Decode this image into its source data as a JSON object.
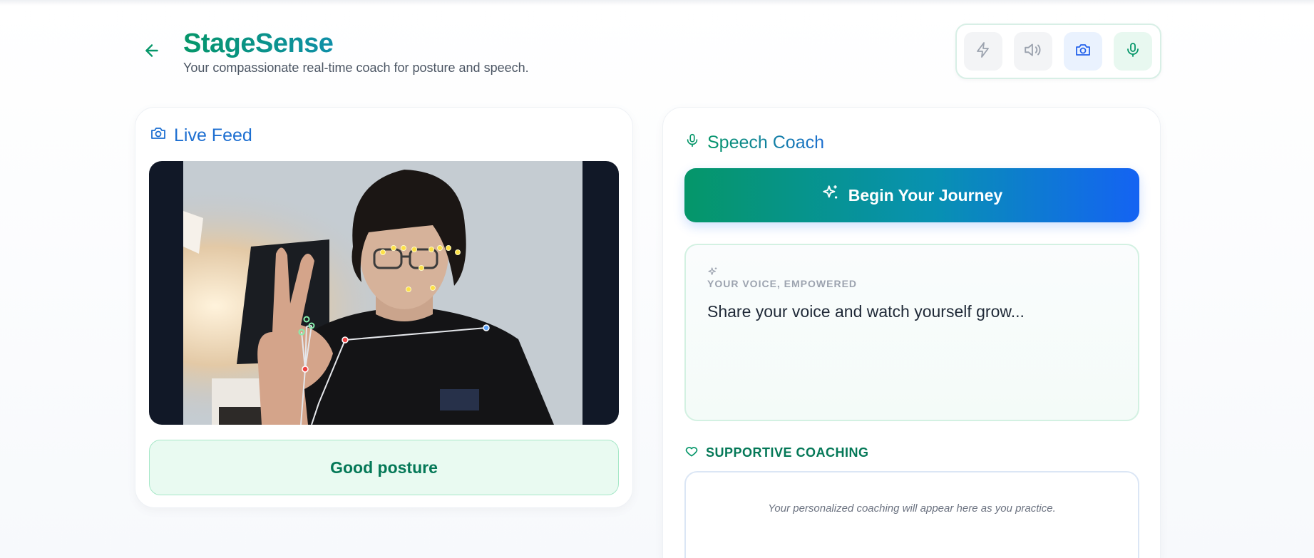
{
  "app": {
    "title": "StageSense",
    "subtitle": "Your compassionate real-time coach for posture and speech."
  },
  "toolbar": {
    "buttons": [
      {
        "icon": "lightning-icon",
        "state": "inactive"
      },
      {
        "icon": "speaker-icon",
        "state": "inactive"
      },
      {
        "icon": "camera-icon",
        "state": "active"
      },
      {
        "icon": "microphone-icon",
        "state": "active"
      }
    ]
  },
  "live_feed": {
    "title": "Live Feed",
    "posture_status": "Good posture"
  },
  "speech_coach": {
    "title": "Speech Coach",
    "begin_button": "Begin Your Journey",
    "voice_label": "YOUR VOICE, EMPOWERED",
    "voice_placeholder": "Share your voice and watch yourself grow...",
    "coaching_header": "SUPPORTIVE COACHING",
    "coaching_placeholder": "Your personalized coaching will appear here as you practice."
  },
  "colors": {
    "brand_green": "#059669",
    "brand_blue": "#1463f3",
    "posture_good_bg": "#e9faf1"
  }
}
